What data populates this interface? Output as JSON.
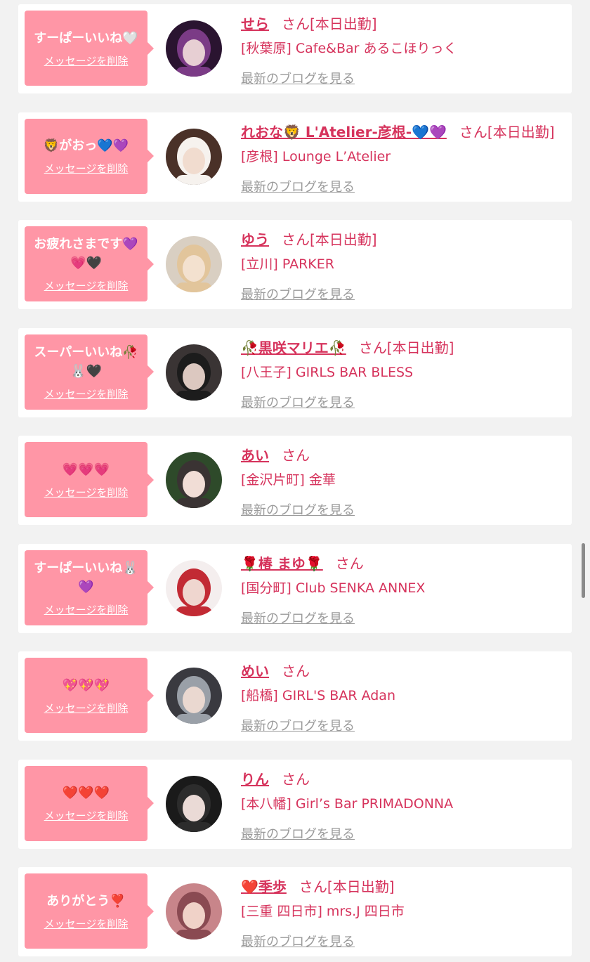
{
  "messages": [
    {
      "message": "すーぱーいいね🤍",
      "delete_label": "メッセージを削除",
      "name": "せら",
      "honorific": "さん[本日出勤]",
      "shop": "[秋葉原] Cafe&Bar あるこほりっく",
      "blog_label": "最新のブログを見る",
      "avatar_colors": [
        "#2a1430",
        "#e7cfd3",
        "#7b3b86"
      ]
    },
    {
      "message": "🦁がおっ💙💜",
      "delete_label": "メッセージを削除",
      "name": "れおな🦁 L'Atelier-彦根-💙💜",
      "honorific": "さん[本日出勤]",
      "shop": "[彦根] Lounge L’Atelier",
      "blog_label": "最新のブログを見る",
      "avatar_colors": [
        "#4a3128",
        "#f1dccf",
        "#f6f2ee"
      ]
    },
    {
      "message": "お疲れさまです💜💗🖤",
      "delete_label": "メッセージを削除",
      "name": "ゆう",
      "honorific": "さん[本日出勤]",
      "shop": "[立川] PARKER",
      "blog_label": "最新のブログを見る",
      "avatar_colors": [
        "#d9cfc2",
        "#f3e1cf",
        "#e2c59b"
      ]
    },
    {
      "message": "スーパーいいね🥀🐰🖤",
      "delete_label": "メッセージを削除",
      "name": "🥀黒咲マリエ🥀",
      "honorific": "さん[本日出勤]",
      "shop": "[八王子] GIRLS BAR BLESS",
      "blog_label": "最新のブログを見る",
      "avatar_colors": [
        "#3a3434",
        "#dcc8c0",
        "#1c1c1c"
      ]
    },
    {
      "message": "💗💗💗",
      "delete_label": "メッセージを削除",
      "name": "あい",
      "honorific": "さん",
      "shop": "[金沢片町] 金華",
      "blog_label": "最新のブログを見る",
      "avatar_colors": [
        "#2e4a2a",
        "#f1ddd6",
        "#3a3333"
      ]
    },
    {
      "message": "すーぱーいいね🐰💜",
      "delete_label": "メッセージを削除",
      "name": "🌹椿 まゆ🌹",
      "honorific": "さん",
      "shop": "[国分町] Club SENKA ANNEX",
      "blog_label": "最新のブログを見る",
      "avatar_colors": [
        "#f4eeee",
        "#efd6cf",
        "#c22a34"
      ]
    },
    {
      "message": "💖💖💖",
      "delete_label": "メッセージを削除",
      "name": "めい",
      "honorific": "さん",
      "shop": "[船橋] GIRL'S BAR Adan",
      "blog_label": "最新のブログを見る",
      "avatar_colors": [
        "#3a3a40",
        "#ead8d0",
        "#9aa0a8"
      ]
    },
    {
      "message": "❤️❤️❤️",
      "delete_label": "メッセージを削除",
      "name": "りん",
      "honorific": "さん",
      "shop": "[本八幡] Girl’s Bar PRIMADONNA",
      "blog_label": "最新のブログを見る",
      "avatar_colors": [
        "#1a1a1a",
        "#eadad6",
        "#2c2c2c"
      ]
    },
    {
      "message": "ありがとう❣️",
      "delete_label": "メッセージを削除",
      "name": "❤️季歩",
      "honorific": "さん[本日出勤]",
      "shop": "[三重 四日市] mrs.J 四日市",
      "blog_label": "最新のブログを見る",
      "avatar_colors": [
        "#c8858a",
        "#f0d2c8",
        "#8a4a52"
      ]
    }
  ]
}
